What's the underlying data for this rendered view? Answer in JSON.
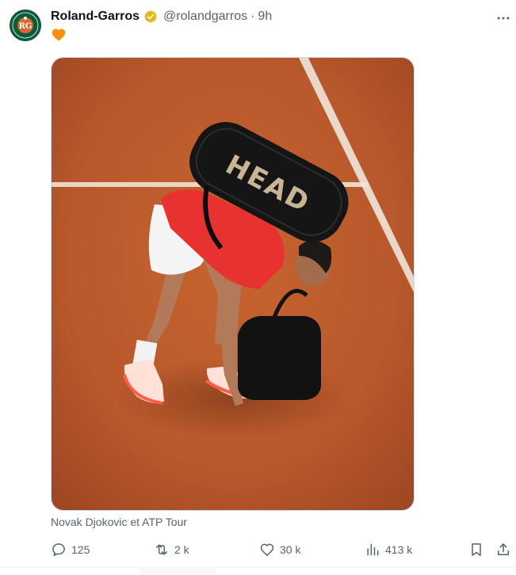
{
  "author": {
    "name": "Roland-Garros",
    "handle": "@rolandgarros",
    "separator": "·",
    "time": "9h",
    "avatar_icon": "roland-garros-logo",
    "verified_icon": "gold-verified-badge"
  },
  "tweet": {
    "text_emoji": "orange-heart-emoji",
    "media_description_icon": "tennis-photo",
    "caption": "Novak Djokovic et ATP Tour",
    "bag_brand": "HEAD"
  },
  "actions": {
    "reply_count": "125",
    "retweet_count": "2 k",
    "like_count": "30 k",
    "view_count": "413 k"
  },
  "colors": {
    "clay": "#b8582c",
    "verified_gold": "#e2b719",
    "muted_text": "#536471",
    "logo_green": "#0b5a3a"
  }
}
